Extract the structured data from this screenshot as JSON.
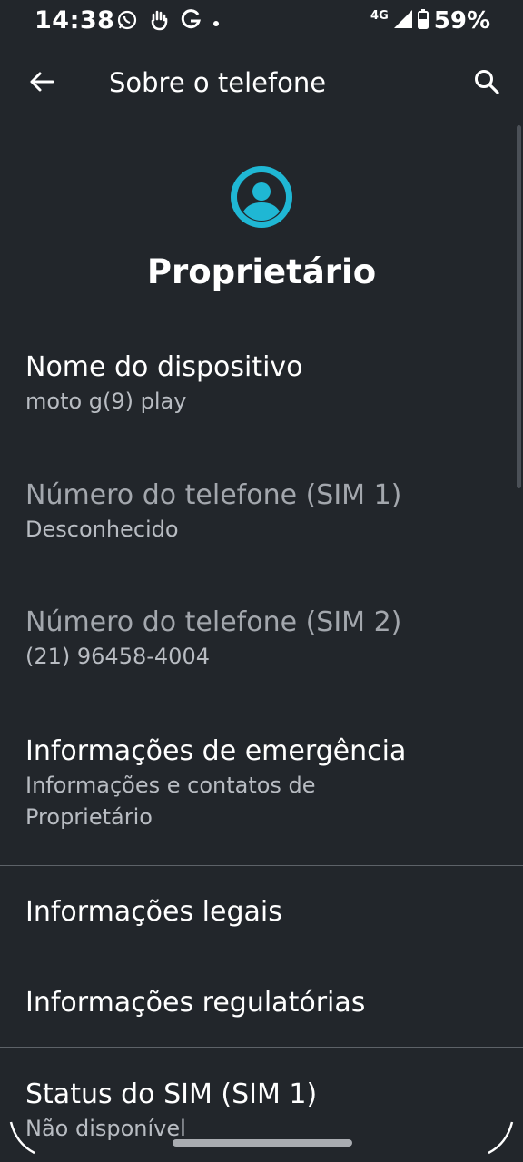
{
  "status_bar": {
    "time": "14:38",
    "network": "4G",
    "battery": "59%",
    "left_icons": [
      "whatsapp-icon",
      "hand-icon",
      "google-icon",
      "dot-icon"
    ],
    "right_icons": [
      "signal-icon",
      "battery-icon"
    ]
  },
  "app_bar": {
    "title": "Sobre o telefone",
    "icons": [
      "back-arrow-icon",
      "search-icon"
    ]
  },
  "owner": {
    "name": "Proprietário",
    "icon": "account-circle-icon",
    "icon_color": "#1fb7d4"
  },
  "items": [
    {
      "title": "Nome do dispositivo",
      "summary": "moto g(9) play",
      "enabled": true
    },
    {
      "title": "Número do telefone (SIM 1)",
      "summary": "Desconhecido",
      "enabled": false
    },
    {
      "title": "Número do telefone (SIM 2)",
      "summary": "(21) 96458-4004",
      "enabled": false
    },
    {
      "title": "Informações de emergência",
      "summary": "Informações e contatos de\nProprietário",
      "enabled": true
    },
    {
      "title": "Informações legais",
      "enabled": true
    },
    {
      "title": "Informações regulatórias",
      "enabled": true
    },
    {
      "title": "Status do SIM (SIM 1)",
      "summary": "Não disponível",
      "enabled": true
    }
  ],
  "colors": {
    "background": "#22262b",
    "accent": "#1fb7d4"
  }
}
